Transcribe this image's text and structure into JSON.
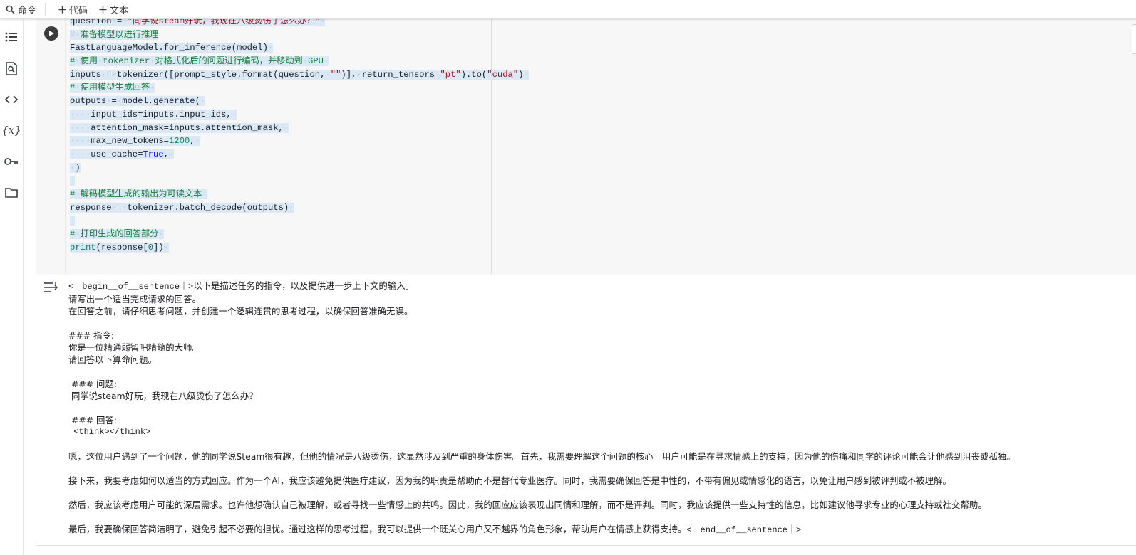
{
  "toolbar": {
    "command_label": "命令",
    "code_label": "代码",
    "text_label": "文本"
  },
  "rail": {
    "icons": [
      "table-of-contents-icon",
      "find-replace-icon",
      "code-snippets-icon",
      "variables-icon",
      "secrets-key-icon",
      "files-folder-icon"
    ],
    "variables_glyph": "{x}"
  },
  "code_cell": {
    "lines": [
      "question = \"同学说steam好玩，我现在八级烫伤了怎么办？\"",
      "# 准备模型以进行推理",
      "FastLanguageModel.for_inference(model)",
      "# 使用 tokenizer 对格式化后的问题进行编码，并移动到 GPU",
      "inputs = tokenizer([prompt_style.format(question, \"\")], return_tensors=\"pt\").to(\"cuda\")",
      "# 使用模型生成回答",
      "outputs = model.generate(",
      "    input_ids=inputs.input_ids,",
      "    attention_mask=inputs.attention_mask,",
      "    max_new_tokens=1200,",
      "    use_cache=True,",
      ")",
      "",
      "# 解码模型生成的输出为可读文本",
      "response = tokenizer.batch_decode(outputs)",
      "",
      "# 打印生成的回答部分",
      "print(response[0])"
    ]
  },
  "output": {
    "bos_token": "<｜begin__of__sentence｜>",
    "line1": "以下是描述任务的指令，以及提供进一步上下文的输入。",
    "line2": "请写出一个适当完成请求的回答。",
    "line3": "在回答之前，请仔细思考问题，并创建一个逻辑连贯的思考过程，以确保回答准确无误。",
    "instr_heading": "### 指令:",
    "instr_1": "你是一位精通弱智吧精髓的大师。",
    "instr_2": "请回答以下算命问题。",
    "question_heading": " ### 问题:",
    "question_text": " 同学说steam好玩，我现在八级烫伤了怎么办？",
    "answer_heading": " ### 回答:",
    "think_tags": " <think></think>",
    "para1": "嗯，这位用户遇到了一个问题，他的同学说Steam很有趣，但他的情况是八级烫伤，这显然涉及到严重的身体伤害。首先，我需要理解这个问题的核心。用户可能是在寻求情感上的支持，因为他的伤痛和同学的评论可能会让他感到沮丧或孤独。",
    "para2": "接下来，我要考虑如何以适当的方式回应。作为一个AI，我应该避免提供医疗建议，因为我的职责是帮助而不是替代专业医疗。同时，我需要确保回答是中性的，不带有偏见或情感化的语言，以免让用户感到被评判或不被理解。",
    "para3": "然后，我应该考虑用户可能的深层需求。也许他想确认自己被理解，或者寻找一些情感上的共鸣。因此，我的回应应该表现出同情和理解，而不是评判。同时，我应该提供一些支持性的信息，比如建议他寻求专业的心理支持或社交帮助。",
    "para4": "最后，我要确保回答简洁明了，避免引起不必要的担忧。通过这样的思考过程，我可以提供一个既关心用户又不越界的角色形象，帮助用户在情感上获得支持。",
    "eos_token": "<｜end__of__sentence｜>"
  }
}
